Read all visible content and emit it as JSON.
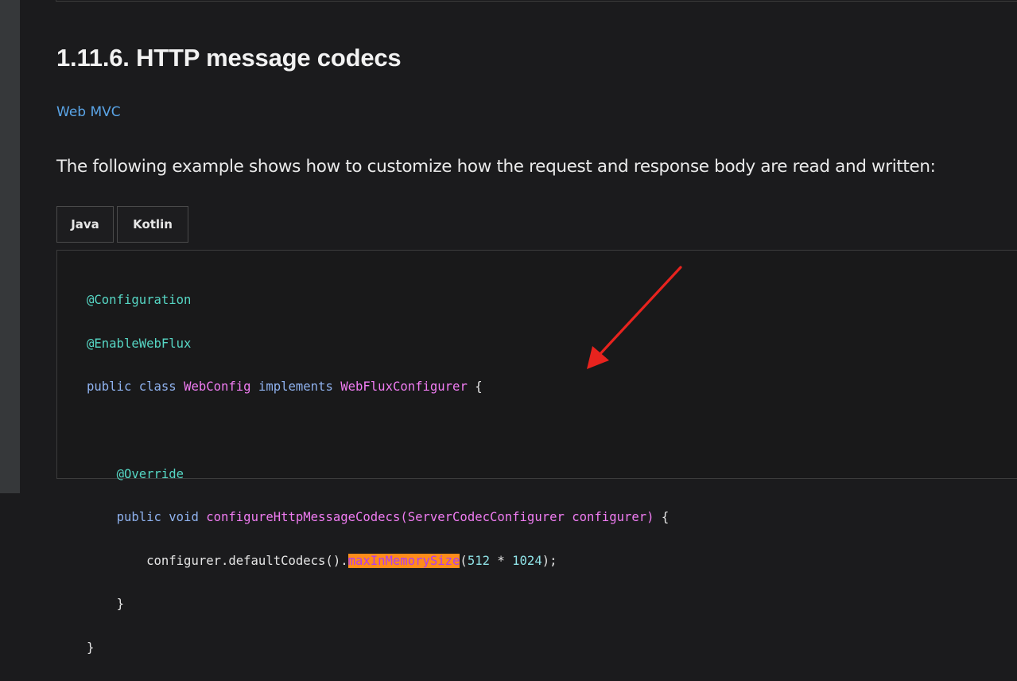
{
  "heading": "1.11.6. HTTP message codecs",
  "link": "Web MVC",
  "paragraph": "The following example shows how to customize how the request and response body are read and written:",
  "tabs": [
    "Java",
    "Kotlin"
  ],
  "code": {
    "line1": "@Configuration",
    "line2": "@EnableWebFlux",
    "line3_kw": "public class ",
    "line3_class": "WebConfig",
    "line3_kw2": " implements ",
    "line3_iface": "WebFluxConfigurer",
    "line3_brace": " {",
    "line5": "@Override",
    "line6_kw": "public void ",
    "line6_method": "configureHttpMessageCodecs(ServerCodecConfigurer configurer)",
    "line6_brace": " {",
    "line7_pre": "configurer.defaultCodecs().",
    "line7_hl": "maxInMemorySize",
    "line7_open": "(",
    "line7_n1": "512",
    "line7_op": " * ",
    "line7_n2": "1024",
    "line7_close": ");",
    "line8": "}",
    "line9": "}"
  },
  "colors": {
    "annotation": "#56d6c4",
    "keyword": "#8fb2ef",
    "type": "#f07cf2",
    "highlight": "#ff8c1a",
    "arrow": "#e8231e",
    "link": "#5aa4e6"
  }
}
